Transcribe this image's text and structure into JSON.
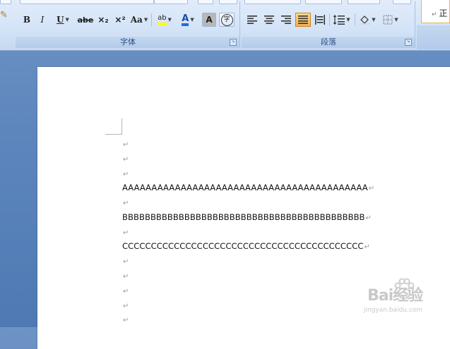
{
  "colors": {
    "ribbon_bg": "#d3e3f7",
    "doc_bg": "#5d86bd",
    "active_button": "#f5b24a",
    "highlight_yellow": "#ffff00",
    "font_color_blue": "#1e6fd9"
  },
  "ribbon": {
    "font_group": {
      "label": "字体",
      "buttons": {
        "bold": "B",
        "italic": "I",
        "underline": "U",
        "strikethrough": "abe",
        "subscript": "×₂",
        "superscript": "×²",
        "change_case": "Aa",
        "highlight": "ab",
        "font_color": "A",
        "char_shading": "A",
        "enclose_char": "字"
      }
    },
    "paragraph_group": {
      "label": "段落"
    },
    "styles_group": {
      "style_label": "正",
      "style_mark": "↵"
    }
  },
  "document": {
    "paragraph_mark": "↵",
    "lines": [
      "",
      "",
      "",
      "AAAAAAAAAAAAAAAAAAAAAAAAAAAAAAAAAAAAAAAAAA",
      "",
      "BBBBBBBBBBBBBBBBBBBBBBBBBBBBBBBBBBBBBBBBBBB",
      "",
      "CCCCCCCCCCCCCCCCCCCCCCCCCCCCCCCCCCCCCCCCCC",
      "",
      "",
      "",
      "",
      ""
    ]
  },
  "watermark": {
    "brand": "Bai经验",
    "url": "jingyan.baidu.com"
  }
}
